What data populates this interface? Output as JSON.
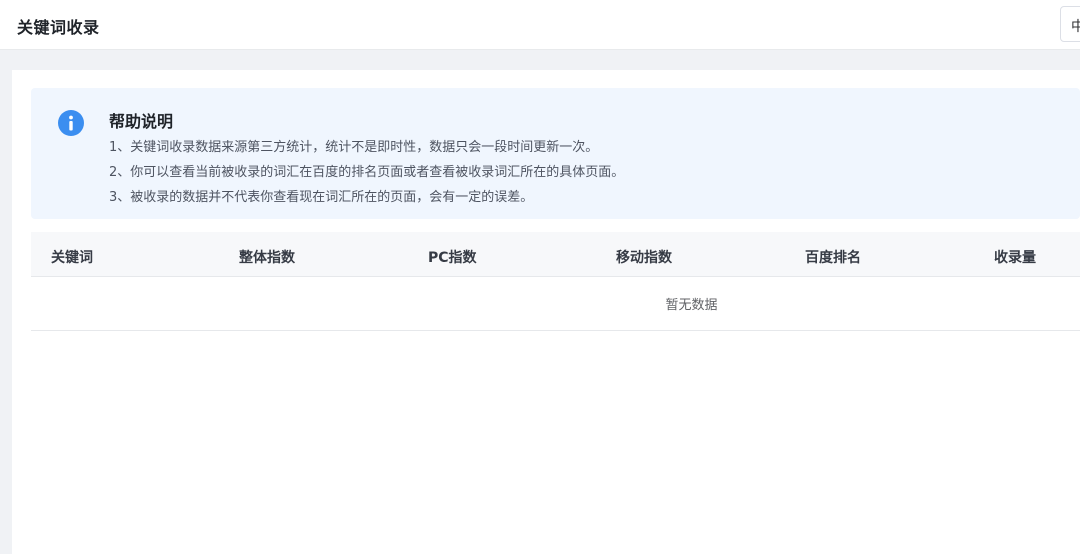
{
  "header": {
    "title": "关键词收录",
    "language_select_value": "中"
  },
  "help": {
    "title": "帮助说明",
    "icon": "info-icon",
    "lines": [
      "1、关键词收录数据来源第三方统计，统计不是即时性，数据只会一段时间更新一次。",
      "2、你可以查看当前被收录的词汇在百度的排名页面或者查看被收录词汇所在的具体页面。",
      "3、被收录的数据并不代表你查看现在词汇所在的页面，会有一定的误差。"
    ]
  },
  "table": {
    "columns": [
      "关键词",
      "整体指数",
      "PC指数",
      "移动指数",
      "百度排名",
      "收录量"
    ],
    "rows": [],
    "empty_text": "暂无数据"
  },
  "colors": {
    "accent": "#3b8ef0",
    "help_background": "#f0f6fe",
    "page_background": "#f0f2f5"
  }
}
